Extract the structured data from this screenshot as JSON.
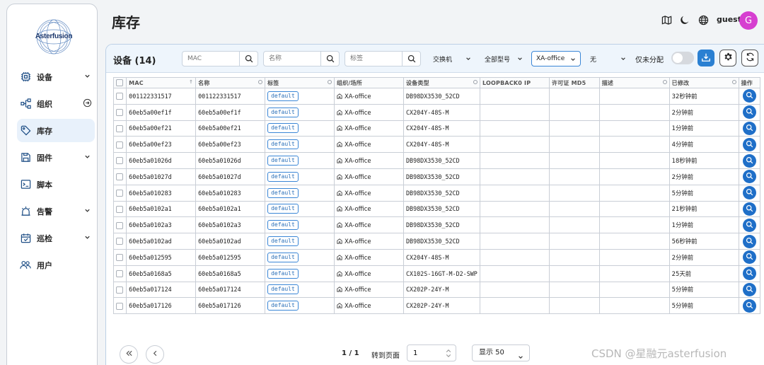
{
  "sidebar": {
    "logo_text": "Asterfusion",
    "items": [
      {
        "label": "设备",
        "icon": "chip-icon",
        "has_caret": true
      },
      {
        "label": "组织",
        "icon": "org-icon",
        "has_arrow": true
      },
      {
        "label": "库存",
        "icon": "tag-icon",
        "active": true
      },
      {
        "label": "固件",
        "icon": "save-icon",
        "has_caret": true
      },
      {
        "label": "脚本",
        "icon": "terminal-icon"
      },
      {
        "label": "告警",
        "icon": "alarm-icon",
        "has_caret": true
      },
      {
        "label": "巡检",
        "icon": "calendar-check-icon",
        "has_caret": true
      },
      {
        "label": "用户",
        "icon": "users-icon"
      }
    ]
  },
  "header": {
    "title": "库存",
    "user": "guest",
    "avatar_letter": "G",
    "avatar_color": "#d63fd0"
  },
  "toolbar": {
    "title": "设备 (14)",
    "search_mac_placeholder": "MAC",
    "search_name_placeholder": "名称",
    "search_tag_placeholder": "标签",
    "device_type": "交换机",
    "model": "全部型号",
    "venue": "XA-office",
    "status": "无",
    "unassigned_label": "仅未分配"
  },
  "table": {
    "columns": [
      "MAC",
      "名称",
      "标签",
      "组织/场所",
      "设备类型",
      "LOOPBACK0 IP",
      "许可证 MD5",
      "描述",
      "已修改",
      "操作"
    ],
    "rows": [
      {
        "mac": "001122331517",
        "name": "001122331517",
        "tag": "default",
        "venue": "XA-office",
        "type": "DB98DX3530_52CD",
        "modified": "32秒钟前"
      },
      {
        "mac": "60eb5a00ef1f",
        "name": "60eb5a00ef1f",
        "tag": "default",
        "venue": "XA-office",
        "type": "CX204Y-48S-M",
        "modified": "2分钟前"
      },
      {
        "mac": "60eb5a00ef21",
        "name": "60eb5a00ef21",
        "tag": "default",
        "venue": "XA-office",
        "type": "CX204Y-48S-M",
        "modified": "1分钟前"
      },
      {
        "mac": "60eb5a00ef23",
        "name": "60eb5a00ef23",
        "tag": "default",
        "venue": "XA-office",
        "type": "CX204Y-48S-M",
        "modified": "4分钟前"
      },
      {
        "mac": "60eb5a01026d",
        "name": "60eb5a01026d",
        "tag": "default",
        "venue": "XA-office",
        "type": "DB98DX3530_52CD",
        "modified": "18秒钟前"
      },
      {
        "mac": "60eb5a01027d",
        "name": "60eb5a01027d",
        "tag": "default",
        "venue": "XA-office",
        "type": "DB98DX3530_52CD",
        "modified": "2分钟前"
      },
      {
        "mac": "60eb5a010283",
        "name": "60eb5a010283",
        "tag": "default",
        "venue": "XA-office",
        "type": "DB98DX3530_52CD",
        "modified": "5分钟前"
      },
      {
        "mac": "60eb5a0102a1",
        "name": "60eb5a0102a1",
        "tag": "default",
        "venue": "XA-office",
        "type": "DB98DX3530_52CD",
        "modified": "21秒钟前"
      },
      {
        "mac": "60eb5a0102a3",
        "name": "60eb5a0102a3",
        "tag": "default",
        "venue": "XA-office",
        "type": "DB98DX3530_52CD",
        "modified": "1分钟前"
      },
      {
        "mac": "60eb5a0102ad",
        "name": "60eb5a0102ad",
        "tag": "default",
        "venue": "XA-office",
        "type": "DB98DX3530_52CD",
        "modified": "56秒钟前"
      },
      {
        "mac": "60eb5a012595",
        "name": "60eb5a012595",
        "tag": "default",
        "venue": "XA-office",
        "type": "CX204Y-48S-M",
        "modified": "2分钟前"
      },
      {
        "mac": "60eb5a0168a5",
        "name": "60eb5a0168a5",
        "tag": "default",
        "venue": "XA-office",
        "type": "CX102S-16GT-M-D2-SWP",
        "modified": "25天前"
      },
      {
        "mac": "60eb5a017124",
        "name": "60eb5a017124",
        "tag": "default",
        "venue": "XA-office",
        "type": "CX202P-24Y-M",
        "modified": "5分钟前"
      },
      {
        "mac": "60eb5a017126",
        "name": "60eb5a017126",
        "tag": "default",
        "venue": "XA-office",
        "type": "CX202P-24Y-M",
        "modified": "5分钟前"
      }
    ]
  },
  "footer": {
    "page_info": "1 / 1",
    "goto_label": "转到页面",
    "page_value": "1",
    "page_size": "显示 50"
  },
  "watermark": "CSDN @星融元asterfusion",
  "colors": {
    "accent": "#2a80d2",
    "action_button": "#1f6fc8",
    "tag_border": "#3a86d6"
  }
}
